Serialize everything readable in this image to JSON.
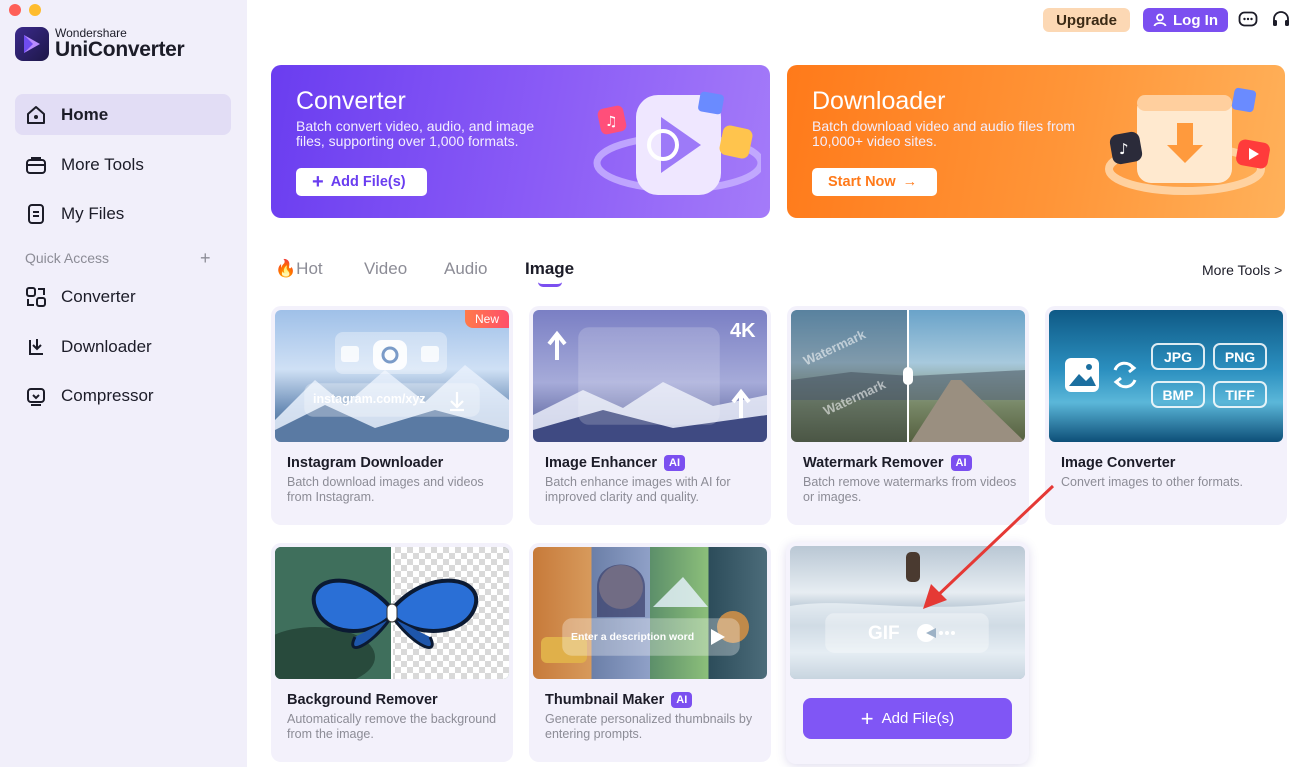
{
  "app": {
    "brand_small": "Wondershare",
    "brand_name": "UniConverter"
  },
  "sidebar": {
    "items": [
      {
        "label": "Home",
        "icon": "home-icon",
        "active": true
      },
      {
        "label": "More Tools",
        "icon": "toolbox-icon"
      },
      {
        "label": "My Files",
        "icon": "files-icon"
      }
    ],
    "quick_access_label": "Quick Access",
    "quick_access_add": "+",
    "quick_items": [
      {
        "label": "Converter",
        "icon": "converter-icon"
      },
      {
        "label": "Downloader",
        "icon": "downloader-icon"
      },
      {
        "label": "Compressor",
        "icon": "compressor-icon"
      }
    ]
  },
  "topbar": {
    "upgrade_label": "Upgrade",
    "login_label": "Log In",
    "icons": [
      "chat-icon",
      "headset-icon"
    ]
  },
  "banners": {
    "converter": {
      "title": "Converter",
      "description": "Batch convert video, audio, and image files, supporting over 1,000 formats.",
      "button": "Add File(s)"
    },
    "downloader": {
      "title": "Downloader",
      "description": "Batch download video and audio files from 10,000+ video sites.",
      "button": "Start Now"
    }
  },
  "tabs": {
    "items": [
      "Hot",
      "Video",
      "Audio",
      "Image"
    ],
    "active": "Image",
    "more_tools": "More Tools >"
  },
  "cards": [
    {
      "title": "Instagram Downloader",
      "ai": false,
      "badge": "New",
      "description": "Batch download images and videos from Instagram.",
      "thumb_text": "instagram.com/xyz"
    },
    {
      "title": "Image Enhancer",
      "ai": true,
      "ai_label": "AI",
      "description": "Batch enhance images with AI for improved clarity and quality.",
      "thumb_text": "4K"
    },
    {
      "title": "Watermark Remover",
      "ai": true,
      "ai_label": "AI",
      "description": "Batch remove watermarks from videos or images.",
      "thumb_text": "Watermark"
    },
    {
      "title": "Image Converter",
      "ai": false,
      "description": "Convert images to other formats.",
      "formats": [
        "JPG",
        "PNG",
        "BMP",
        "TIFF"
      ]
    },
    {
      "title": "Background Remover",
      "ai": false,
      "description": "Automatically remove the background from the image."
    },
    {
      "title": "Thumbnail Maker",
      "ai": true,
      "ai_label": "AI",
      "description": "Generate personalized thumbnails by entering prompts.",
      "thumb_text": "Enter a description word"
    },
    {
      "title": "",
      "thumb_text": "GIF",
      "button": "Add File(s)"
    }
  ],
  "colors": {
    "accent": "#7b4ff0",
    "downloader": "#ff7a1a",
    "sidebar_bg": "#f1effa",
    "annotation_arrow": "#e53935"
  }
}
